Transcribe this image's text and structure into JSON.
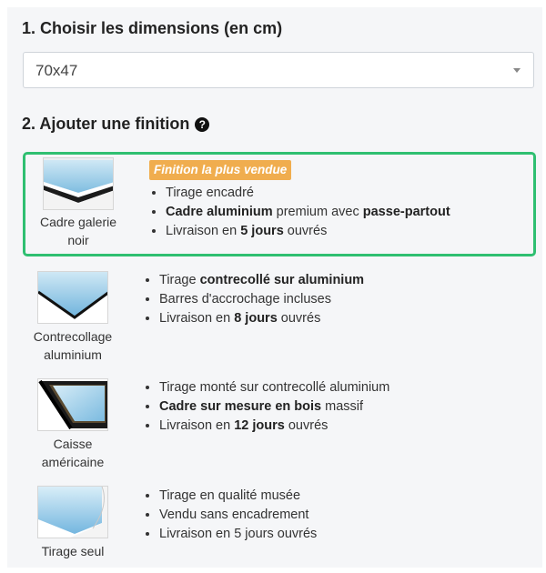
{
  "dimensions": {
    "title": "1. Choisir les dimensions (en cm)",
    "selected": "70x47"
  },
  "finish": {
    "title": "2. Ajouter une finition",
    "help_icon": "question-circle-icon",
    "accent_color": "#2fbf71",
    "badge_color": "#f0ad4e",
    "badge": "Finition la plus vendue",
    "options": [
      {
        "label": "Cadre galerie noir",
        "label_lines": [
          "Cadre galerie",
          "noir"
        ],
        "selected": true,
        "features": [
          [
            {
              "t": "Tirage encadré",
              "b": false
            }
          ],
          [
            {
              "t": "Cadre aluminium",
              "b": true
            },
            {
              "t": " premium avec ",
              "b": false
            },
            {
              "t": "passe-partout",
              "b": true
            }
          ],
          [
            {
              "t": "Livraison en ",
              "b": false
            },
            {
              "t": "5 jours",
              "b": true
            },
            {
              "t": " ouvrés",
              "b": false
            }
          ]
        ]
      },
      {
        "label": "Contrecollage aluminium",
        "label_lines": [
          "Contrecollage",
          "aluminium"
        ],
        "selected": false,
        "features": [
          [
            {
              "t": "Tirage ",
              "b": false
            },
            {
              "t": "contrecollé sur aluminium",
              "b": true
            }
          ],
          [
            {
              "t": "Barres d'accrochage incluses",
              "b": false
            }
          ],
          [
            {
              "t": "Livraison en ",
              "b": false
            },
            {
              "t": "8 jours",
              "b": true
            },
            {
              "t": " ouvrés",
              "b": false
            }
          ]
        ]
      },
      {
        "label": "Caisse américaine",
        "label_lines": [
          "Caisse",
          "américaine"
        ],
        "selected": false,
        "features": [
          [
            {
              "t": "Tirage monté sur contrecollé aluminium",
              "b": false
            }
          ],
          [
            {
              "t": "Cadre sur mesure en bois",
              "b": true
            },
            {
              "t": " massif",
              "b": false
            }
          ],
          [
            {
              "t": "Livraison en ",
              "b": false
            },
            {
              "t": "12 jours",
              "b": true
            },
            {
              "t": " ouvrés",
              "b": false
            }
          ]
        ]
      },
      {
        "label": "Tirage seul",
        "label_lines": [
          "Tirage seul"
        ],
        "selected": false,
        "features": [
          [
            {
              "t": "Tirage en qualité musée",
              "b": false
            }
          ],
          [
            {
              "t": "Vendu sans encadrement",
              "b": false
            }
          ],
          [
            {
              "t": "Livraison en 5 jours ouvrés",
              "b": false
            }
          ]
        ]
      }
    ]
  }
}
